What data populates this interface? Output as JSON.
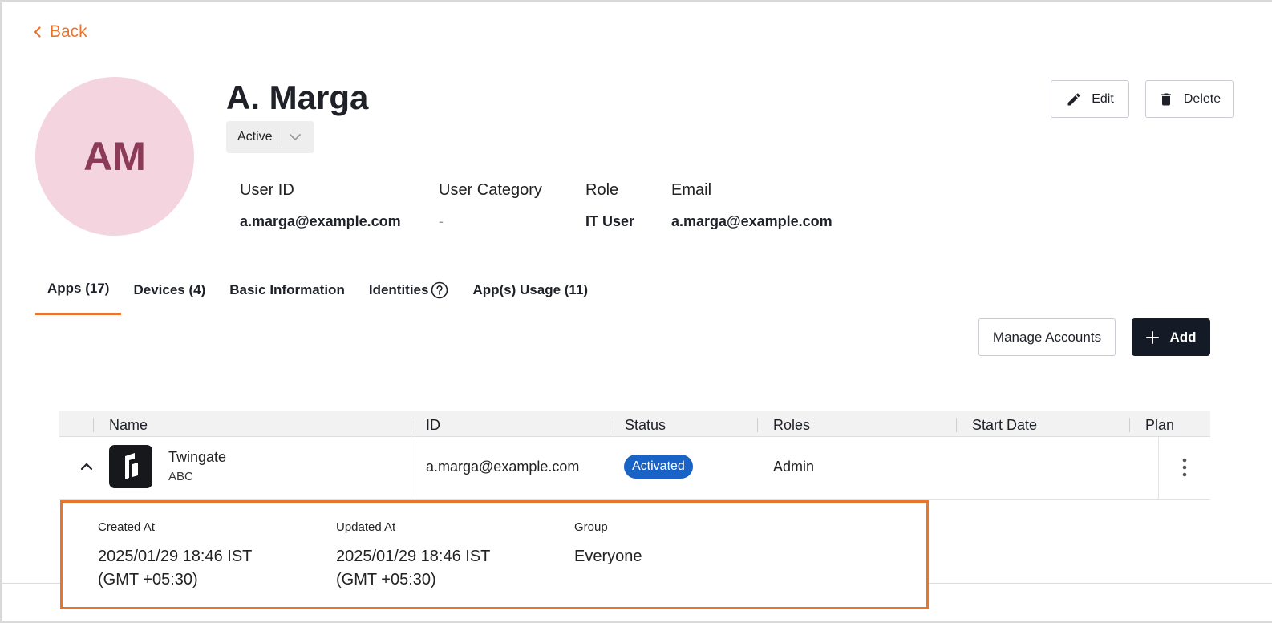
{
  "nav": {
    "back_label": "Back"
  },
  "user": {
    "initials": "AM",
    "name": "A. Marga",
    "status": "Active"
  },
  "actions": {
    "edit_label": "Edit",
    "delete_label": "Delete"
  },
  "info": {
    "user_id_label": "User ID",
    "user_id_value": "a.marga@example.com",
    "category_label": "User Category",
    "category_value": "-",
    "role_label": "Role",
    "role_value": "IT User",
    "email_label": "Email",
    "email_value": "a.marga@example.com"
  },
  "tabs": [
    {
      "label": "Apps (17)"
    },
    {
      "label": "Devices (4)"
    },
    {
      "label": "Basic Information"
    },
    {
      "label": "Identities"
    },
    {
      "label": "App(s) Usage (11)"
    }
  ],
  "toolbar": {
    "manage_label": "Manage Accounts",
    "add_label": "Add"
  },
  "table": {
    "columns": [
      "Name",
      "ID",
      "Status",
      "Roles",
      "Start Date",
      "Plan"
    ],
    "row": {
      "app_name": "Twingate",
      "app_org": "ABC",
      "id": "a.marga@example.com",
      "status": "Activated",
      "roles": "Admin"
    }
  },
  "details": {
    "created_label": "Created At",
    "created_line1": "2025/01/29 18:46 IST",
    "created_line2": "(GMT +05:30)",
    "updated_label": "Updated At",
    "updated_line1": "2025/01/29 18:46 IST",
    "updated_line2": "(GMT +05:30)",
    "group_label": "Group",
    "group_value": "Everyone"
  },
  "colors": {
    "accent": "#e8752e",
    "avatar_bg": "#f4d4de",
    "avatar_text": "#8b3a58",
    "badge": "#1a63c6",
    "primary_button": "#151b26"
  }
}
